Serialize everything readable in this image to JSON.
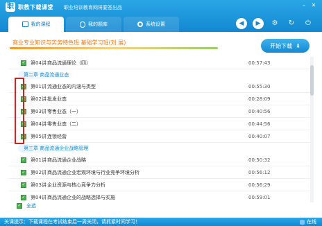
{
  "app": {
    "logo_char": "职",
    "title": "职教下载课堂",
    "subtitle": "职业培训教育网将要签出品"
  },
  "window_controls": [
    "–",
    "✕"
  ],
  "tabs": [
    {
      "label": "我的课程",
      "active": true
    },
    {
      "label": "我的题库",
      "active": false
    },
    {
      "label": "系统设置",
      "active": false
    }
  ],
  "top_icons": {
    "back": "◀",
    "forward": "▶",
    "settings": "⚙",
    "refresh": "↻",
    "power": "⏻"
  },
  "course": {
    "title": "商业专业知识与实务特色班  基础学习班(刘    展)",
    "start_button": "开始下载",
    "start_icon": "⬇"
  },
  "lessons": [
    {
      "num": "第04讲",
      "title": "商品流通理论（四）",
      "duration": "00:57:43"
    },
    {
      "chapter": "第二章   商品流通业态"
    },
    {
      "num": "第01讲",
      "title": "流通业态的内涵与类型",
      "duration": "00:55:30"
    },
    {
      "num": "第02讲",
      "title": "批发业态",
      "duration": "00:28:09"
    },
    {
      "num": "第03讲",
      "title": "零售业态（一）",
      "duration": "00:40:56"
    },
    {
      "num": "第04讲",
      "title": "零售业态（二）",
      "duration": "00:44:56"
    },
    {
      "num": "第05讲",
      "title": "连锁经营",
      "duration": "00:40:07"
    },
    {
      "chapter": "第三章   商品流通企业战略管理"
    },
    {
      "num": "第01讲",
      "title": "商品流通企业战略",
      "duration": "00:50:32"
    },
    {
      "num": "第02讲",
      "title": "商品流通企业宏观环境与行业竞争环境分析",
      "duration": "00:56:12"
    },
    {
      "num": "第03讲",
      "title": "企业资源与核心竞争力分析",
      "duration": "00:56:29"
    },
    {
      "num": "第04讲",
      "title": "商品流通企业的战略选择与实施",
      "duration": "00:59:01"
    }
  ],
  "footer": {
    "select_all": "全选",
    "status_text": "关课提示：下载课程在考试结束后一周关闭，请抓紧时间学习！",
    "online": "在线"
  },
  "colors": {
    "brand": "#1a8fd8",
    "accent": "#f07a1a",
    "check": "#4caf50"
  }
}
